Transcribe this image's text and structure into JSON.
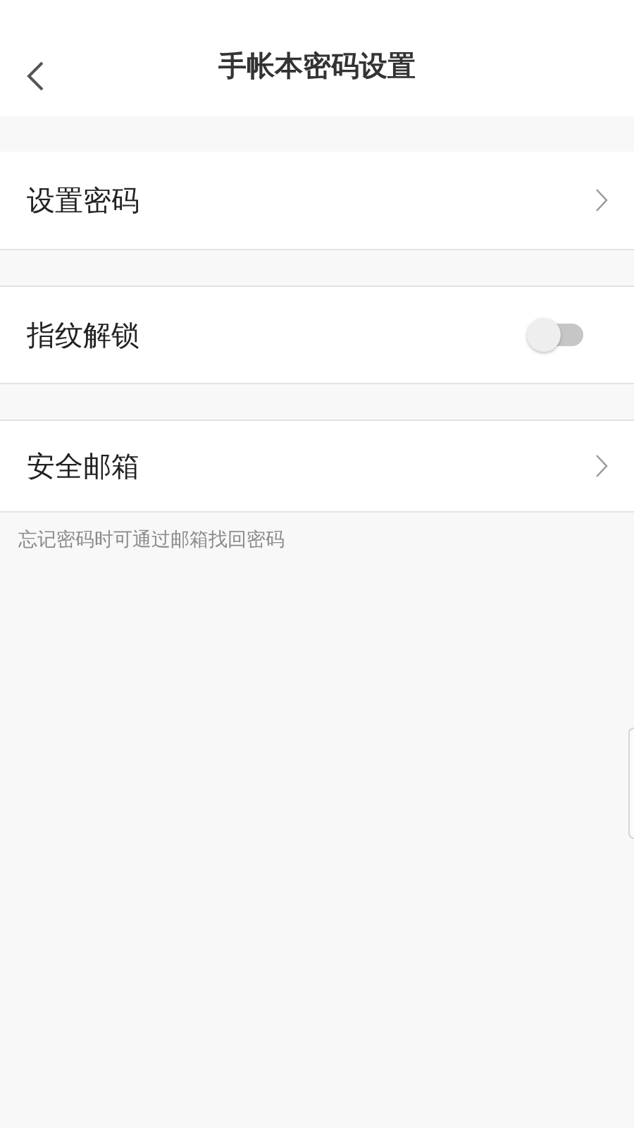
{
  "header": {
    "title": "手帐本密码设置"
  },
  "settings": [
    {
      "kind": "link",
      "label": "设置密码"
    },
    {
      "kind": "switch",
      "label": "指纹解锁",
      "on": false
    },
    {
      "kind": "link",
      "label": "安全邮箱"
    }
  ],
  "hint": "忘记密码时可通过邮箱找回密码"
}
